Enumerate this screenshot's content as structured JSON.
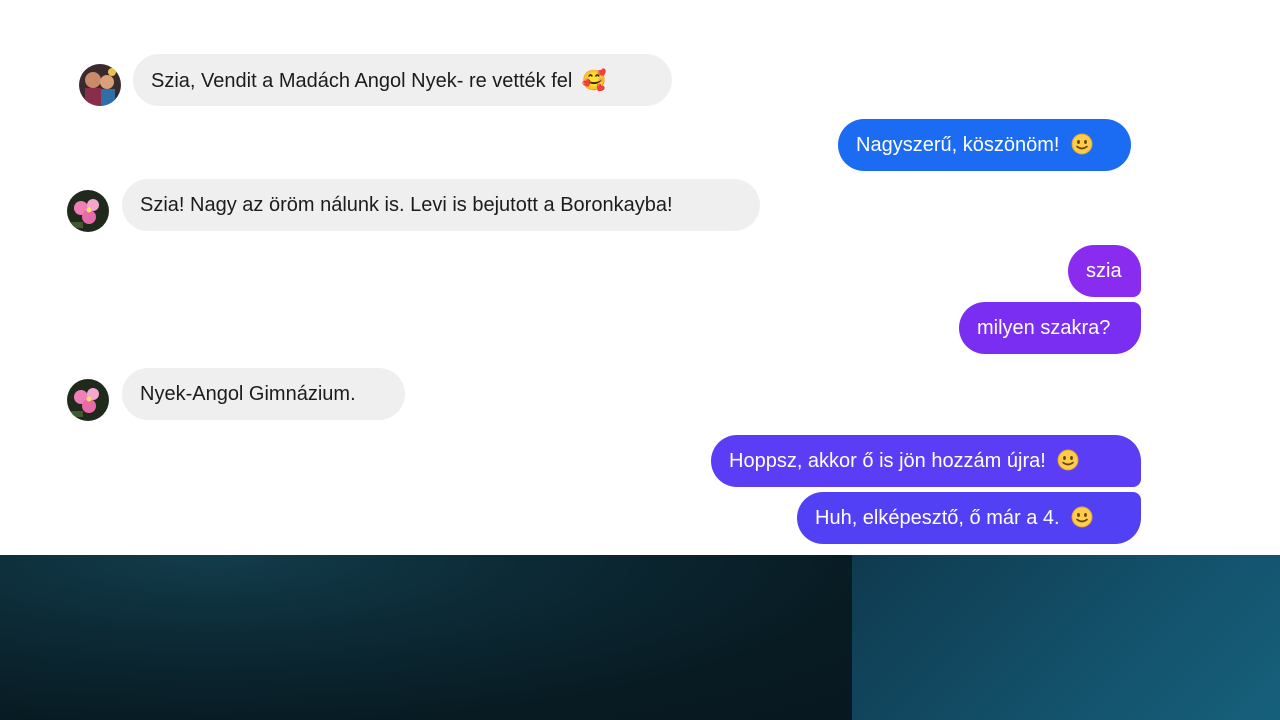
{
  "conversation": {
    "messages": [
      {
        "sender": "contact-1",
        "direction": "incoming",
        "text": "Szia, Vendit a Madách Angol Nyek- re vették fel",
        "emoji": "smiling-face-with-hearts",
        "emoji_char": "🥰"
      },
      {
        "sender": "me",
        "direction": "outgoing",
        "text": "Nagyszerű, köszönöm!",
        "emoji": "slightly-smiling-face",
        "color": "#1b6cf2"
      },
      {
        "sender": "contact-2",
        "direction": "incoming",
        "text": "Szia! Nagy az öröm nálunk is. Levi is bejutott a Boronkayba!"
      },
      {
        "sender": "me",
        "direction": "outgoing",
        "text": "szia",
        "color": "#8a2cf0"
      },
      {
        "sender": "me",
        "direction": "outgoing",
        "text": "milyen szakra?",
        "color": "#7a2ef2"
      },
      {
        "sender": "contact-2",
        "direction": "incoming",
        "text": "Nyek-Angol Gimnázium."
      },
      {
        "sender": "me",
        "direction": "outgoing",
        "text": "Hoppsz, akkor ő is jön hozzám újra!",
        "emoji": "slightly-smiling-face",
        "color": "#5a3df5"
      },
      {
        "sender": "me",
        "direction": "outgoing",
        "text": "Huh, elképesztő, ő már a 4.",
        "emoji": "slightly-smiling-face",
        "color": "#5240f5"
      }
    ]
  },
  "colors": {
    "incoming_bubble": "#efefef",
    "incoming_text": "#1c1c1c",
    "outgoing_text": "#ffffff",
    "band_left": "#081a22",
    "band_right": "#135069"
  }
}
